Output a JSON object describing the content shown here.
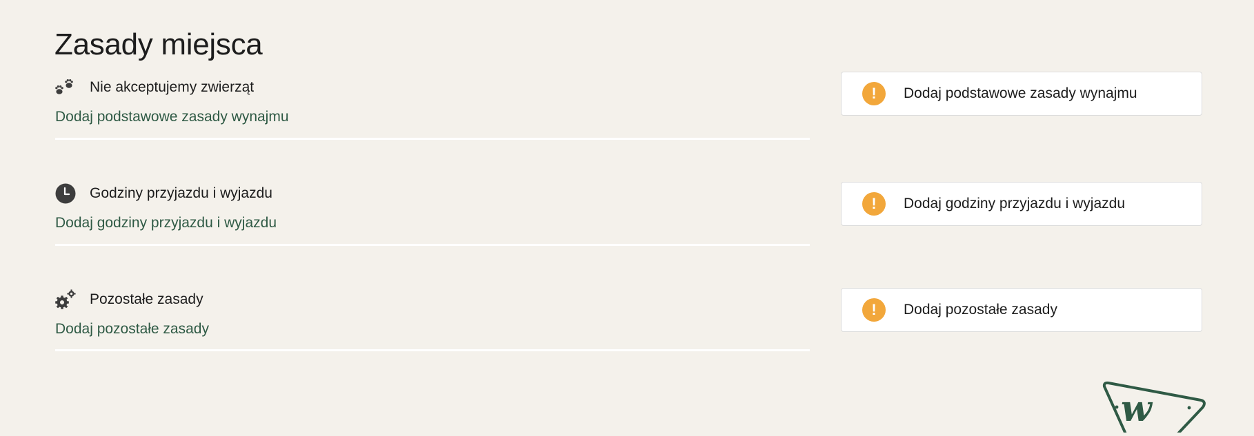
{
  "page": {
    "title": "Zasady miejsca"
  },
  "sections": [
    {
      "icon": "paw-icon",
      "title": "Nie akceptujemy zwierząt",
      "link": "Dodaj podstawowe zasady wynajmu"
    },
    {
      "icon": "clock-icon",
      "title": "Godziny przyjazdu i wyjazdu",
      "link": "Dodaj godziny przyjazdu i wyjazdu"
    },
    {
      "icon": "gears-icon",
      "title": "Pozostałe zasady",
      "link": "Dodaj pozostałe zasady"
    }
  ],
  "cards": [
    {
      "icon": "warning-icon",
      "symbol": "!",
      "label": "Dodaj podstawowe zasady wynajmu"
    },
    {
      "icon": "warning-icon",
      "symbol": "!",
      "label": "Dodaj godziny przyjazdu i wyjazdu"
    },
    {
      "icon": "warning-icon",
      "symbol": "!",
      "label": "Dodaj pozostałe zasady"
    }
  ],
  "colors": {
    "background": "#f4f1eb",
    "link": "#2f5a45",
    "warning": "#f2a73b",
    "logo": "#2f5a45"
  },
  "logo": {
    "icon": "brand-logo-icon",
    "letter": "w"
  }
}
